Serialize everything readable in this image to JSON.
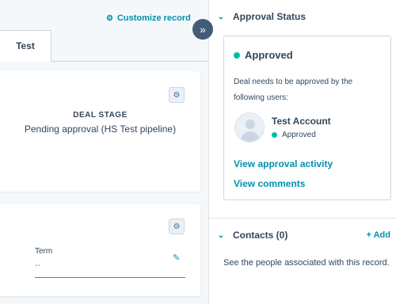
{
  "header": {
    "customize_label": "Customize record",
    "customize_icon": "gear-icon"
  },
  "tabs": [
    {
      "label": "Test",
      "active": true
    }
  ],
  "deal_stage_card": {
    "label": "DEAL STAGE",
    "value": "Pending approval (HS Test pipeline)"
  },
  "term_card": {
    "label": "Term",
    "value": "--"
  },
  "sidebar": {
    "collapse_icon": "double-chevron-right-icon",
    "approval": {
      "title": "Approval Status",
      "status": "Approved",
      "status_color": "#00bda5",
      "description": "Deal needs to be approved by the following users:",
      "user": {
        "name": "Test Account",
        "status": "Approved"
      },
      "links": {
        "activity": "View approval activity",
        "comments": "View comments"
      }
    },
    "contacts": {
      "title": "Contacts (0)",
      "add_label": "+ Add",
      "description": "See the people associated with this record."
    }
  },
  "colors": {
    "accent": "#0091ae",
    "collapse_button": "#425b76"
  }
}
